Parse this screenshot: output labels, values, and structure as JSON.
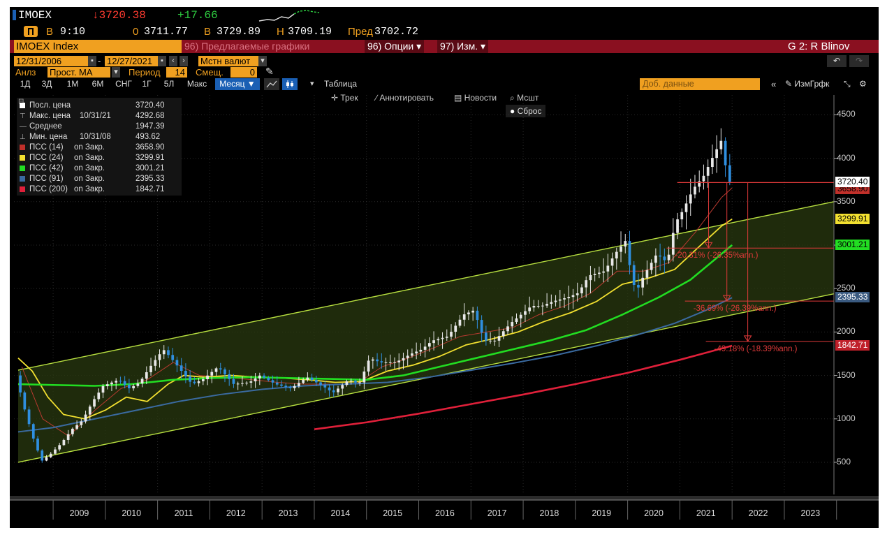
{
  "header": {
    "ticker": "IMOEX",
    "last_price": "↓3720.38",
    "change": "+17.66",
    "session_badge": "B",
    "time": "9:10",
    "open_label": "0",
    "open_value": "3711.77",
    "bid_label": "B",
    "bid_value": "3729.89",
    "high_label": "H",
    "high_value": "3709.19",
    "prev_label": "Пред",
    "prev_value": "3702.72"
  },
  "menu": {
    "security": "IMOEX Index",
    "suggested_charts": "96) Предлагаемые графики",
    "options": "96) Опции",
    "edit": "97) Изм.",
    "chart_id": "G 2: R Blinov"
  },
  "controls": {
    "date_from": "12/31/2006",
    "date_to": "12/27/2021",
    "currency": "Мстн валют",
    "analysis_label": "Анлз",
    "analysis_value": "Прост. MA",
    "period_label": "Период",
    "period_value": "14",
    "shift_label": "Смещ.",
    "shift_value": "0"
  },
  "timeframes": [
    "1Д",
    "3Д",
    "1М",
    "6М",
    "СНГ",
    "1Г",
    "5Л",
    "Макс",
    "Месяц ▼"
  ],
  "table_button": "Таблица",
  "add_data_placeholder": "Доб. данные",
  "edit_chart_button": "ИзмГрфк",
  "toolbar": {
    "track": "Трек",
    "annotate": "Аннотировать",
    "news": "Новости",
    "zoom": "Мсшт",
    "reset": "Сброс"
  },
  "legend": [
    {
      "label": "Посл. цена",
      "date": "",
      "value": "3720.40",
      "color": "#ffffff",
      "icon": "square"
    },
    {
      "label": "Макс. цена",
      "date": "10/31/21",
      "value": "4292.68",
      "color": "#aaaaaa",
      "icon": "max-marker"
    },
    {
      "label": "Среднее",
      "date": "",
      "value": "1947.39",
      "color": "#aaaaaa",
      "icon": "average-marker"
    },
    {
      "label": "Мин. цена",
      "date": "10/31/08",
      "value": "493.62",
      "color": "#aaaaaa",
      "icon": "min-marker"
    },
    {
      "label": "ПСС (14)",
      "date": "on Закр.",
      "value": "3658.90",
      "color": "#c0302a",
      "icon": "square"
    },
    {
      "label": "ПСС (24)",
      "date": "on Закр.",
      "value": "3299.91",
      "color": "#f2e030",
      "icon": "square"
    },
    {
      "label": "ПСС (42)",
      "date": "on Закр.",
      "value": "3001.21",
      "color": "#22dd22",
      "icon": "square"
    },
    {
      "label": "ПСС (91)",
      "date": "on Закр.",
      "value": "2395.33",
      "color": "#3a6aa0",
      "icon": "square"
    },
    {
      "label": "ПСС (200)",
      "date": "on Закр.",
      "value": "1842.71",
      "color": "#e0203a",
      "icon": "square"
    }
  ],
  "price_tags": [
    {
      "value": "3720.40",
      "y": 3720.4,
      "bg": "#ffffff",
      "fg": "#000000"
    },
    {
      "value": "3658.90",
      "y": 3640,
      "bg": "#c0302a",
      "fg": "#000000"
    },
    {
      "value": "3299.91",
      "y": 3299.91,
      "bg": "#f2e030",
      "fg": "#000000"
    },
    {
      "value": "3001.21",
      "y": 3001.21,
      "bg": "#22dd22",
      "fg": "#000000"
    },
    {
      "value": "2395.33",
      "y": 2395.33,
      "bg": "#3a5a80",
      "fg": "#ffffff"
    },
    {
      "value": "1842.71",
      "y": 1842.71,
      "bg": "#c0202a",
      "fg": "#ffffff"
    }
  ],
  "annotations": [
    {
      "text": "-20.31% (-26.35%ann.)",
      "x": 2021.55,
      "target": 2966
    },
    {
      "text": "-36.69% (-26.39%ann.)",
      "x": 2021.9,
      "target": 2356
    },
    {
      "text": "-49.18% (-18.39%ann.)",
      "x": 2022.3,
      "target": 1892
    }
  ],
  "chart_data": {
    "type": "candlestick",
    "title": "",
    "xlabel": "",
    "ylabel": "",
    "x_ticks": [
      "2009",
      "2010",
      "2011",
      "2012",
      "2013",
      "2014",
      "2015",
      "2016",
      "2017",
      "2018",
      "2019",
      "2020",
      "2021",
      "2022",
      "2023"
    ],
    "y_ticks": [
      500,
      1000,
      1500,
      2000,
      2500,
      3000,
      3500,
      4000,
      4500
    ],
    "xlim": [
      2008.25,
      2023.95
    ],
    "ylim": [
      130,
      4680
    ],
    "grid": true,
    "legend_position": "top-left",
    "price_path": [
      [
        2008.33,
        1500
      ],
      [
        2008.5,
        1100
      ],
      [
        2008.7,
        700
      ],
      [
        2008.83,
        520
      ],
      [
        2009.0,
        600
      ],
      [
        2009.2,
        720
      ],
      [
        2009.4,
        880
      ],
      [
        2009.6,
        980
      ],
      [
        2009.8,
        1200
      ],
      [
        2010.0,
        1380
      ],
      [
        2010.3,
        1450
      ],
      [
        2010.5,
        1350
      ],
      [
        2010.7,
        1420
      ],
      [
        2010.9,
        1600
      ],
      [
        2011.15,
        1800
      ],
      [
        2011.3,
        1700
      ],
      [
        2011.5,
        1550
      ],
      [
        2011.7,
        1400
      ],
      [
        2011.9,
        1450
      ],
      [
        2012.2,
        1600
      ],
      [
        2012.5,
        1400
      ],
      [
        2012.8,
        1420
      ],
      [
        2013.0,
        1500
      ],
      [
        2013.3,
        1400
      ],
      [
        2013.6,
        1350
      ],
      [
        2013.9,
        1480
      ],
      [
        2014.2,
        1380
      ],
      [
        2014.4,
        1300
      ],
      [
        2014.7,
        1450
      ],
      [
        2014.9,
        1400
      ],
      [
        2015.1,
        1700
      ],
      [
        2015.3,
        1650
      ],
      [
        2015.6,
        1650
      ],
      [
        2015.9,
        1750
      ],
      [
        2016.1,
        1800
      ],
      [
        2016.3,
        1900
      ],
      [
        2016.6,
        1950
      ],
      [
        2016.9,
        2200
      ],
      [
        2017.1,
        2250
      ],
      [
        2017.3,
        1900
      ],
      [
        2017.5,
        1900
      ],
      [
        2017.8,
        2100
      ],
      [
        2018.0,
        2200
      ],
      [
        2018.2,
        2300
      ],
      [
        2018.4,
        2300
      ],
      [
        2018.6,
        2350
      ],
      [
        2018.9,
        2400
      ],
      [
        2019.1,
        2450
      ],
      [
        2019.3,
        2650
      ],
      [
        2019.6,
        2700
      ],
      [
        2019.8,
        2900
      ],
      [
        2020.0,
        3050
      ],
      [
        2020.1,
        2700
      ],
      [
        2020.2,
        2450
      ],
      [
        2020.35,
        2650
      ],
      [
        2020.6,
        2900
      ],
      [
        2020.8,
        2800
      ],
      [
        2020.95,
        3250
      ],
      [
        2021.1,
        3400
      ],
      [
        2021.3,
        3650
      ],
      [
        2021.5,
        3800
      ],
      [
        2021.7,
        4050
      ],
      [
        2021.83,
        4200
      ],
      [
        2021.9,
        3950
      ],
      [
        2022.0,
        3720
      ]
    ],
    "series": [
      {
        "name": "ПСС (14)",
        "color": "#b83a30",
        "values": [
          [
            2008.4,
            1600
          ],
          [
            2008.8,
            1000
          ],
          [
            2009.3,
            800
          ],
          [
            2009.8,
            1100
          ],
          [
            2010.3,
            1350
          ],
          [
            2010.8,
            1450
          ],
          [
            2011.3,
            1650
          ],
          [
            2011.8,
            1500
          ],
          [
            2012.3,
            1480
          ],
          [
            2012.8,
            1450
          ],
          [
            2013.3,
            1420
          ],
          [
            2013.8,
            1400
          ],
          [
            2014.3,
            1400
          ],
          [
            2014.8,
            1400
          ],
          [
            2015.3,
            1600
          ],
          [
            2015.8,
            1700
          ],
          [
            2016.3,
            1820
          ],
          [
            2016.8,
            1950
          ],
          [
            2017.3,
            2000
          ],
          [
            2017.8,
            2050
          ],
          [
            2018.3,
            2200
          ],
          [
            2018.8,
            2300
          ],
          [
            2019.3,
            2450
          ],
          [
            2019.8,
            2700
          ],
          [
            2020.3,
            2700
          ],
          [
            2020.8,
            2800
          ],
          [
            2021.3,
            3150
          ],
          [
            2021.8,
            3550
          ],
          [
            2022.0,
            3658
          ]
        ]
      },
      {
        "name": "ПСС (24)",
        "color": "#f2e030",
        "values": [
          [
            2008.33,
            1700
          ],
          [
            2008.6,
            1550
          ],
          [
            2008.9,
            1250
          ],
          [
            2009.2,
            1050
          ],
          [
            2009.6,
            1000
          ],
          [
            2010.0,
            1100
          ],
          [
            2010.4,
            1250
          ],
          [
            2010.8,
            1200
          ],
          [
            2011.2,
            1400
          ],
          [
            2011.5,
            1500
          ],
          [
            2011.9,
            1480
          ],
          [
            2012.4,
            1500
          ],
          [
            2012.9,
            1480
          ],
          [
            2013.4,
            1470
          ],
          [
            2013.9,
            1450
          ],
          [
            2014.4,
            1420
          ],
          [
            2014.9,
            1430
          ],
          [
            2015.4,
            1550
          ],
          [
            2015.9,
            1620
          ],
          [
            2016.4,
            1720
          ],
          [
            2016.9,
            1850
          ],
          [
            2017.4,
            1920
          ],
          [
            2017.9,
            2000
          ],
          [
            2018.4,
            2120
          ],
          [
            2018.9,
            2220
          ],
          [
            2019.4,
            2350
          ],
          [
            2019.9,
            2550
          ],
          [
            2020.4,
            2620
          ],
          [
            2020.9,
            2720
          ],
          [
            2021.4,
            3000
          ],
          [
            2021.8,
            3220
          ],
          [
            2022.0,
            3299
          ]
        ]
      },
      {
        "name": "ПСС (42)",
        "color": "#22dd22",
        "values": [
          [
            2008.33,
            1400
          ],
          [
            2009.0,
            1390
          ],
          [
            2009.8,
            1380
          ],
          [
            2010.5,
            1400
          ],
          [
            2011.3,
            1450
          ],
          [
            2012.0,
            1470
          ],
          [
            2012.8,
            1480
          ],
          [
            2013.5,
            1470
          ],
          [
            2014.3,
            1460
          ],
          [
            2015.0,
            1450
          ],
          [
            2015.7,
            1500
          ],
          [
            2016.4,
            1600
          ],
          [
            2017.1,
            1700
          ],
          [
            2017.8,
            1800
          ],
          [
            2018.5,
            1900
          ],
          [
            2019.2,
            2020
          ],
          [
            2019.9,
            2200
          ],
          [
            2020.6,
            2400
          ],
          [
            2021.2,
            2600
          ],
          [
            2021.7,
            2850
          ],
          [
            2022.0,
            3001
          ]
        ]
      },
      {
        "name": "ПСС (91)",
        "color": "#3a6aa0",
        "values": [
          [
            2008.33,
            850
          ],
          [
            2009.0,
            900
          ],
          [
            2009.8,
            1000
          ],
          [
            2010.6,
            1100
          ],
          [
            2011.4,
            1200
          ],
          [
            2012.2,
            1280
          ],
          [
            2013.0,
            1340
          ],
          [
            2013.8,
            1380
          ],
          [
            2014.6,
            1400
          ],
          [
            2015.4,
            1420
          ],
          [
            2016.2,
            1480
          ],
          [
            2017.0,
            1560
          ],
          [
            2017.8,
            1640
          ],
          [
            2018.6,
            1730
          ],
          [
            2019.4,
            1840
          ],
          [
            2020.2,
            1970
          ],
          [
            2020.9,
            2100
          ],
          [
            2021.5,
            2250
          ],
          [
            2022.0,
            2395
          ]
        ]
      },
      {
        "name": "ПСС (200)",
        "color": "#e0203a",
        "values": [
          [
            2014.0,
            880
          ],
          [
            2015.0,
            960
          ],
          [
            2016.0,
            1060
          ],
          [
            2017.0,
            1170
          ],
          [
            2018.0,
            1280
          ],
          [
            2019.0,
            1400
          ],
          [
            2020.0,
            1530
          ],
          [
            2021.0,
            1680
          ],
          [
            2022.0,
            1842
          ]
        ]
      }
    ],
    "channel": {
      "upper": [
        [
          2008.33,
          1560
        ],
        [
          2023.95,
          3500
        ]
      ],
      "lower": [
        [
          2008.33,
          500
        ],
        [
          2023.95,
          2440
        ]
      ]
    },
    "horizontal_level": {
      "y": 3720.4,
      "x_from": 2020.95,
      "x_to": 2023.95
    }
  }
}
